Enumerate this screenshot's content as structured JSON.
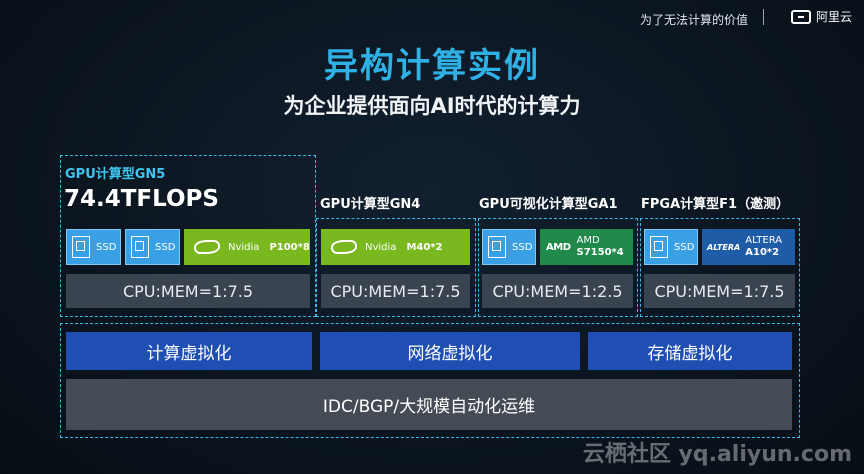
{
  "header": {
    "tagline": "为了无法计算的价值",
    "brand": "阿里云"
  },
  "title": "异构计算实例",
  "subtitle": "为企业提供面向AI时代的计算力",
  "instances": {
    "gn5": {
      "name": "GPU计算型GN5",
      "perf": "74.4TFLOPS",
      "ssd1": "SSD",
      "ssd2": "SSD",
      "gpu_brand": "Nvidia",
      "gpu_model": "P100*8",
      "ratio": "CPU:MEM=1:7.5"
    },
    "gn4": {
      "name": "GPU计算型GN4",
      "gpu_brand": "Nvidia",
      "gpu_model": "M40*2",
      "ratio": "CPU:MEM=1:7.5"
    },
    "ga1": {
      "name": "GPU可视化计算型GA1",
      "ssd": "SSD",
      "gpu_logo": "AMD",
      "gpu_brand": "AMD",
      "gpu_model": "S7150*4",
      "ratio": "CPU:MEM=1:2.5"
    },
    "f1": {
      "name": "FPGA计算型F1（邀测）",
      "ssd": "SSD",
      "fpga_logo": "ALTERA",
      "fpga_brand": "ALTERA",
      "fpga_model": "A10*2",
      "ratio": "CPU:MEM=1:7.5"
    }
  },
  "virtualization": {
    "compute": "计算虚拟化",
    "network": "网络虚拟化",
    "storage": "存储虚拟化"
  },
  "infrastructure": "IDC/BGP/大规模自动化运维",
  "watermark": "云栖社区 yq.aliyun.com",
  "colors": {
    "title": "#2fb1e6",
    "ssd": "#3aa0e6",
    "nvidia": "#7ab81f",
    "amd": "#1f8a4a",
    "altera": "#1f5ca8",
    "virtualization": "#1f4fb2",
    "ratio_bg": "#3a4350"
  }
}
